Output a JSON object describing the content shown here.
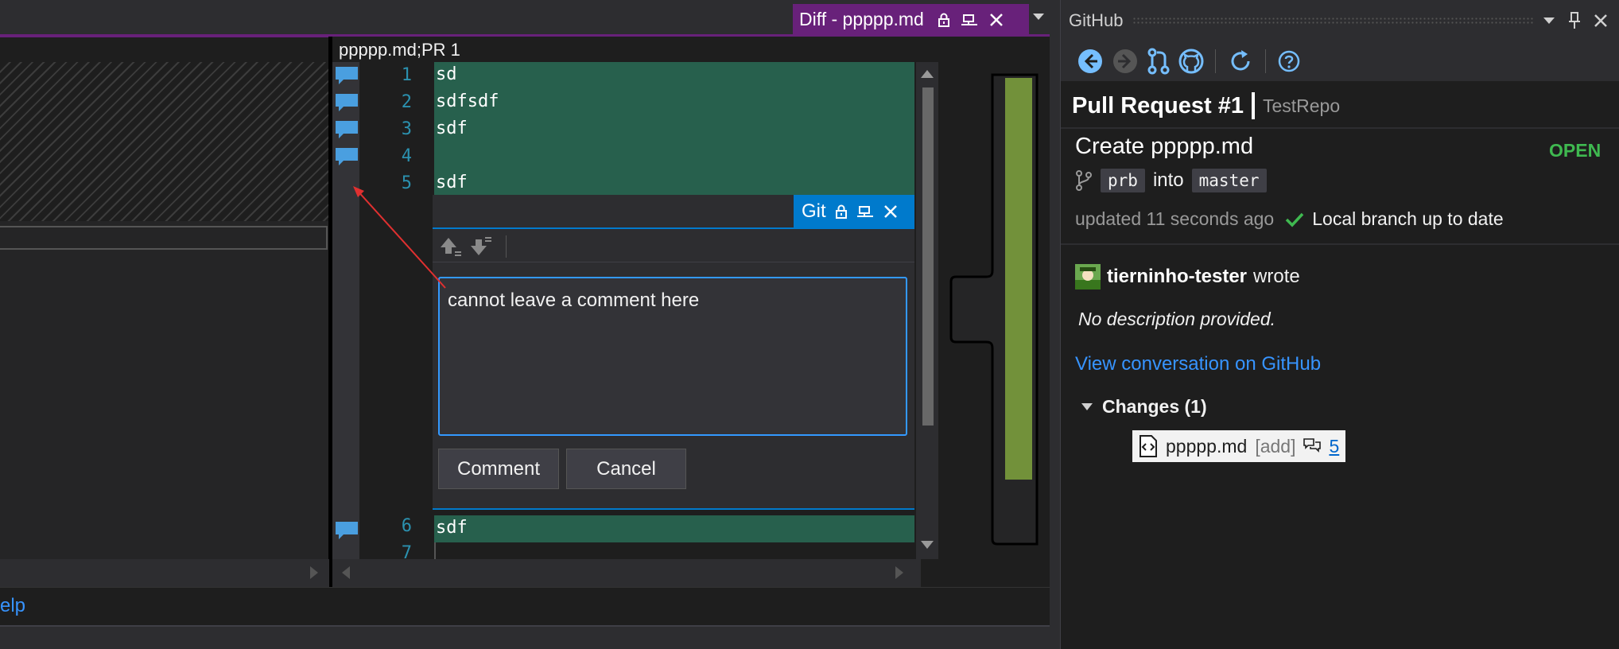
{
  "editor": {
    "diff_tab_title": "Diff - ppppp.md",
    "file_header": "ppppp.md;PR 1",
    "line_numbers": [
      "1",
      "2",
      "3",
      "4",
      "5",
      "6",
      "7"
    ],
    "code_lines": [
      "sd",
      "sdfsdf",
      "sdf",
      "",
      "sdf",
      "sdf"
    ],
    "help_link": "elp"
  },
  "comment_box": {
    "tab_title": "Git",
    "text": "cannot leave a comment here",
    "comment_button": "Comment",
    "cancel_button": "Cancel"
  },
  "github": {
    "panel_title": "GitHub",
    "pr_number": "Pull Request #1",
    "repo": "TestRepo",
    "pr_title": "Create ppppp.md",
    "state": "OPEN",
    "source_branch": "prb",
    "into_label": "into",
    "target_branch": "master",
    "updated": "updated 11 seconds ago",
    "local_status": "Local branch up to date",
    "author": "tierninho-tester",
    "wrote": "wrote",
    "description": "No description provided.",
    "view_link": "View conversation on GitHub",
    "changes_label": "Changes (1)",
    "file_name": "ppppp.md",
    "file_status": "[add]",
    "file_comment_count": "5"
  },
  "colors": {
    "accent_purple": "#68217a",
    "accent_blue": "#007acc",
    "diff_added_bg": "#27604d",
    "open_state": "#3fb950",
    "link": "#3794ff"
  }
}
